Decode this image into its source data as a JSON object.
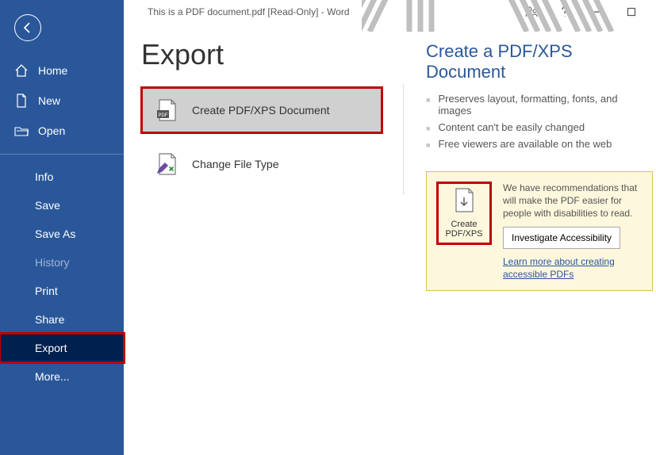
{
  "titlebar": {
    "title": "This is a PDF document.pdf  [Read-Only]  -  Word"
  },
  "sidebar": {
    "home": "Home",
    "new": "New",
    "open": "Open",
    "info": "Info",
    "save": "Save",
    "save_as": "Save As",
    "history": "History",
    "print": "Print",
    "share": "Share",
    "export": "Export",
    "more": "More..."
  },
  "page": {
    "heading": "Export",
    "option_pdf": "Create PDF/XPS Document",
    "option_change": "Change File Type"
  },
  "detail": {
    "title": "Create a PDF/XPS Document",
    "bullets": [
      "Preserves layout, formatting, fonts, and images",
      "Content can't be easily changed",
      "Free viewers are available on the web"
    ],
    "create_label": "Create PDF/XPS",
    "rec_text": "We have recommendations that will make the PDF easier for people with disabilities to read.",
    "investigate": "Investigate Accessibility",
    "learn_more": "Learn more about creating accessible PDFs"
  }
}
